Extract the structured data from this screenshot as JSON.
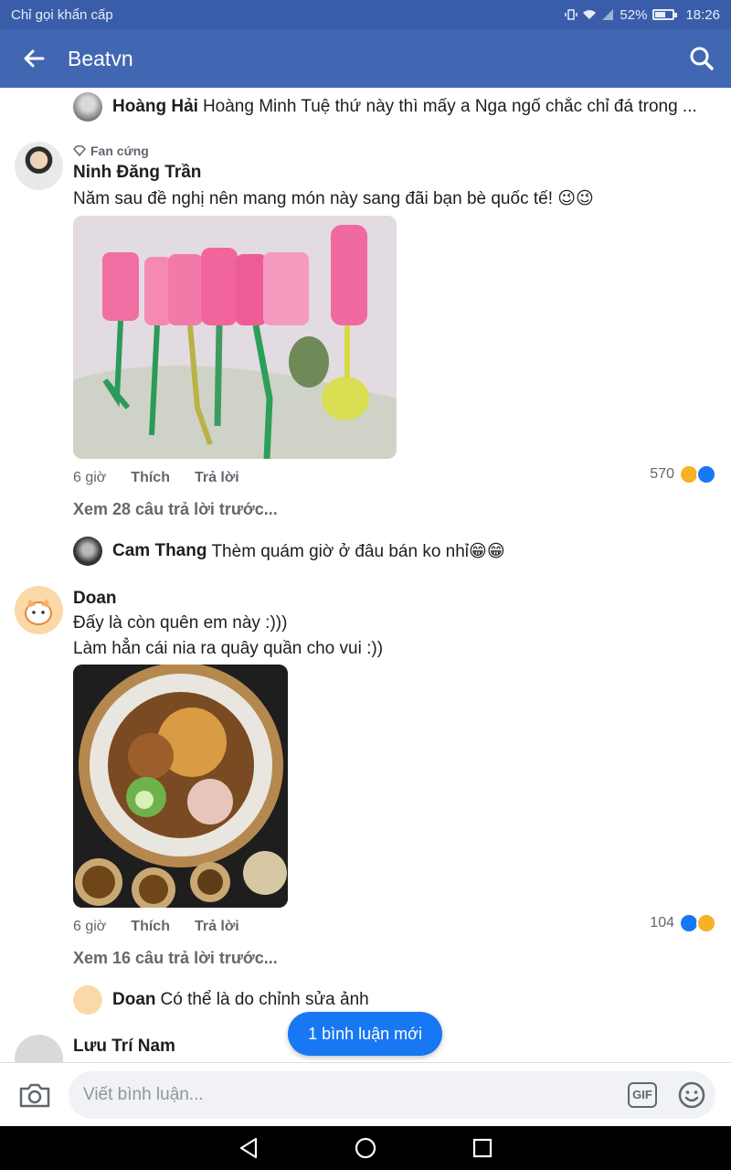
{
  "status_bar": {
    "carrier": "Chỉ gọi khẩn cấp",
    "battery": "52%",
    "time": "18:26",
    "battery_level": 0.52
  },
  "header": {
    "title": "Beatvn",
    "back_icon": "arrow-left-icon",
    "search_icon": "search-icon"
  },
  "comments": [
    {
      "type": "reply",
      "author": "Hoàng Hải",
      "text": "Hoàng Minh Tuệ thứ này thì mấy a Nga ngố chắc chỉ đá trong ..."
    },
    {
      "type": "comment",
      "badge": "Fan cứng",
      "author": "Ninh Đăng Trần",
      "text": "Năm sau đề nghị nên mang món này sang đãi bạn bè quốc tế! 😉😉",
      "time": "6 giờ",
      "like": "Thích",
      "reply": "Trả lời",
      "reaction_count": "570",
      "more_replies": "Xem 28 câu trả lời trước..."
    },
    {
      "type": "reply",
      "author": "Cam Thang",
      "text": "Thèm quám giờ ở đâu bán ko nhỉ😁😁"
    },
    {
      "type": "comment",
      "author": "Doan",
      "text_line1": "Đấy là còn quên em này :)))",
      "text_line2": "Làm hẳn cái nia ra quây quần cho vui :))",
      "time": "6 giờ",
      "like": "Thích",
      "reply": "Trả lời",
      "reaction_count": "104",
      "more_replies": "Xem 16 câu trả lời trước..."
    },
    {
      "type": "reply",
      "author": "Doan",
      "text": "Có thể là do chỉnh sửa ảnh"
    },
    {
      "type": "comment",
      "author": "Lưu Trí Nam"
    }
  ],
  "new_comments_button": "1 bình luận mới",
  "composer": {
    "placeholder": "Viết bình luận...",
    "gif_label": "GIF"
  },
  "colors": {
    "brand": "#4267b2",
    "status_bar": "#3a5daa",
    "accent": "#1877f2"
  }
}
